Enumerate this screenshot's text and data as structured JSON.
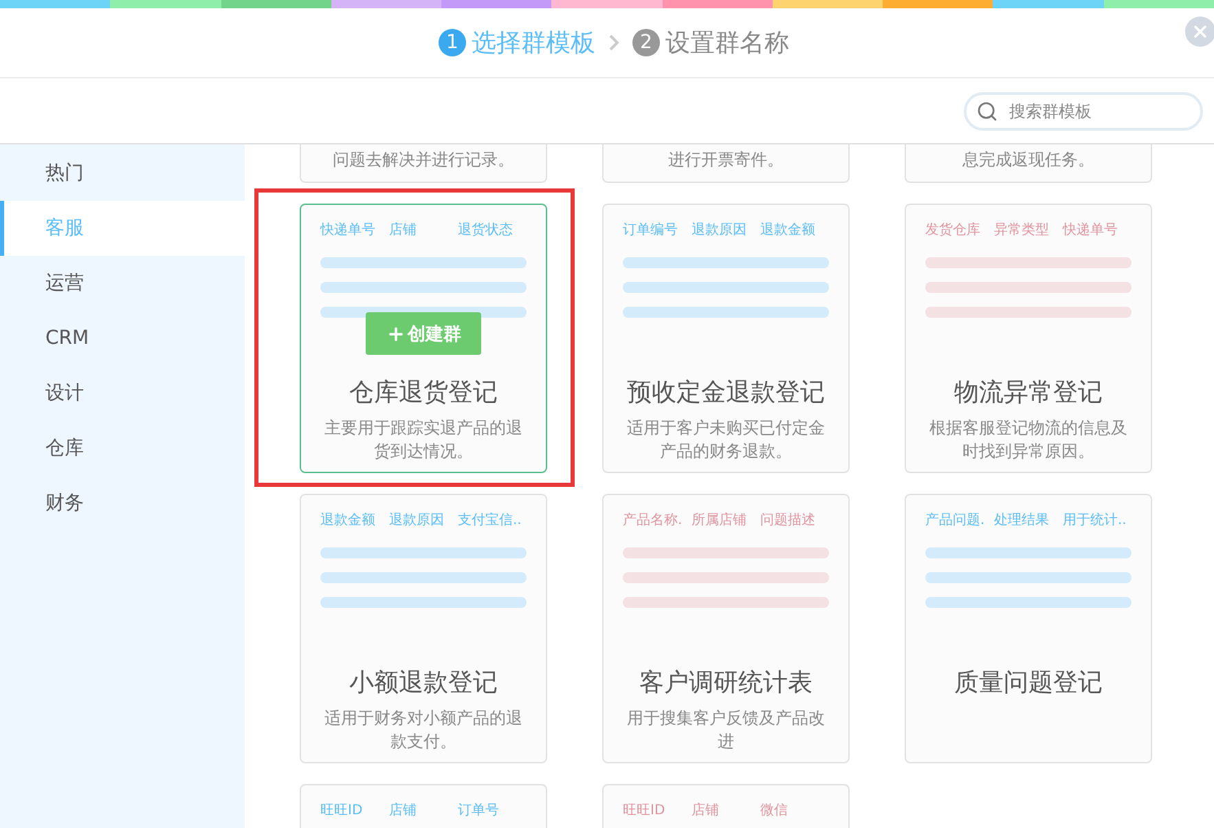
{
  "header": {
    "steps": [
      {
        "number": "1",
        "label": "选择群模板",
        "selected": true
      },
      {
        "number": "2",
        "label": "设置群名称",
        "selected": false
      }
    ]
  },
  "search": {
    "placeholder": "搜索群模板"
  },
  "sidebar": {
    "items": [
      {
        "label": "热门",
        "selected": false
      },
      {
        "label": "客服",
        "selected": true
      },
      {
        "label": "运营",
        "selected": false
      },
      {
        "label": "CRM",
        "selected": false
      },
      {
        "label": "设计",
        "selected": false
      },
      {
        "label": "仓库",
        "selected": false
      },
      {
        "label": "财务",
        "selected": false
      }
    ]
  },
  "create_button": "创建群",
  "cards": [
    {
      "kind": "partial-top",
      "description": "问题去解决并进行记录。"
    },
    {
      "kind": "partial-top",
      "description": "进行开票寄件。"
    },
    {
      "kind": "partial-top",
      "description": "息完成返现任务。"
    },
    {
      "kind": "full",
      "color": "#5bbdf8",
      "selected": true,
      "fields": [
        "快递单号",
        "店铺",
        "退货状态"
      ],
      "title": "仓库退货登记",
      "description": "主要用于跟踪实退产品的退货到达情况。"
    },
    {
      "kind": "full",
      "color": "#5bbdf8",
      "selected": false,
      "fields": [
        "订单编号",
        "退款原因",
        "退款金额"
      ],
      "title": "预收定金退款登记",
      "description": "适用于客户未购买已付定金产品的财务退款。"
    },
    {
      "kind": "full",
      "color": "#e0949e",
      "selected": false,
      "fields": [
        "发货仓库",
        "异常类型",
        "快递单号"
      ],
      "title": "物流异常登记",
      "description": "根据客服登记物流的信息及时找到异常原因。"
    },
    {
      "kind": "full",
      "color": "#5bbdf8",
      "selected": false,
      "fields": [
        "退款金额",
        "退款原因",
        "支付宝信.."
      ],
      "title": "小额退款登记",
      "description": "适用于财务对小额产品的退款支付。"
    },
    {
      "kind": "full",
      "color": "#e0949e",
      "selected": false,
      "fields": [
        "产品名称.",
        "所属店铺",
        "问题描述"
      ],
      "title": "客户调研统计表",
      "description": "用于搜集客户反馈及产品改进"
    },
    {
      "kind": "full",
      "color": "#5bbdf8",
      "selected": false,
      "fields": [
        "产品问题.",
        "处理结果",
        "用于统计.."
      ],
      "title": "质量问题登记"
    },
    {
      "kind": "partial-bottom",
      "color": "#5bbdf8",
      "fields": [
        "旺旺ID",
        "店铺",
        "订单号"
      ]
    },
    {
      "kind": "partial-bottom",
      "color": "#e0949e",
      "fields": [
        "旺旺ID",
        "店铺",
        "微信"
      ]
    }
  ]
}
